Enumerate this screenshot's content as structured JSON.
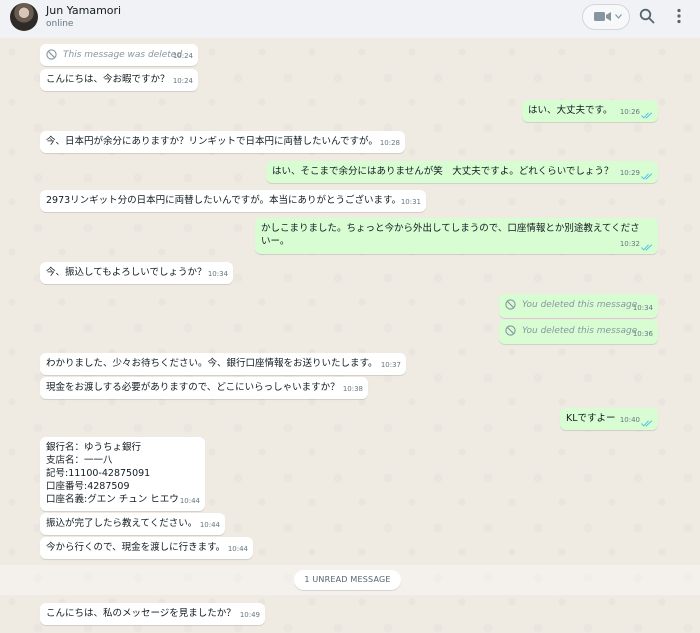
{
  "header": {
    "contact_name": "Jun Yamamori",
    "status": "online",
    "icons": [
      "avatar",
      "video-camera-icon",
      "chevron-down-icon",
      "search-icon",
      "kebab-menu-icon"
    ]
  },
  "colors": {
    "header_bg": "#f0f2f5",
    "chat_bg": "#efeae2",
    "incoming_bubble": "#ffffff",
    "outgoing_bubble": "#d9fdd3",
    "read_ticks": "#53bdeb"
  },
  "messages": [
    {
      "dir": "in",
      "deleted": true,
      "text": "This message was deleted",
      "time": "10:24"
    },
    {
      "dir": "in",
      "text": "こんにちは、今お暇ですか？",
      "time": "10:24"
    },
    {
      "dir": "out",
      "text": "はい、大丈夫です。",
      "time": "10:26"
    },
    {
      "dir": "in",
      "text": "今、日本円が余分にありますか？リンギットで日本円に両替したいんですが。",
      "time": "10:28"
    },
    {
      "dir": "out",
      "text": "はい、そこまで余分にはありませんが笑　大丈夫ですよ。どれくらいでしょう？",
      "time": "10:29"
    },
    {
      "dir": "in",
      "text": "2973リンギット分の日本円に両替したいんですが。本当にありがとうございます。",
      "time": "10:31"
    },
    {
      "dir": "out",
      "text": "かしこまりました。ちょっと今から外出してしまうので、口座情報とか別途教えてくださ\nいー。",
      "time": "10:32"
    },
    {
      "dir": "in",
      "text": "今、振込してもよろしいでしょうか？",
      "time": "10:34"
    },
    {
      "dir": "out",
      "deleted": true,
      "text": "You deleted this message",
      "time": "10:34"
    },
    {
      "dir": "out",
      "deleted": true,
      "text": "You deleted this message",
      "time": "10:36"
    },
    {
      "dir": "in",
      "text": "わかりました、少々お待ちください。今、銀行口座情報をお送りいたします。",
      "time": "10:37"
    },
    {
      "dir": "in",
      "text": "現金をお渡しする必要がありますので、どこにいらっしゃいますか？",
      "time": "10:38"
    },
    {
      "dir": "out",
      "text": "KLですよー",
      "time": "10:40"
    },
    {
      "dir": "in",
      "text": "銀行名：ゆうちょ銀行\n支店名：一一八\n記号:11100-42875091\n口座番号:4287509\n口座名義:グエン チュン ヒエウ",
      "time": "10:44"
    },
    {
      "dir": "in",
      "text": "振込が完了したら教えてください。",
      "time": "10:44"
    },
    {
      "dir": "in",
      "text": "今から行くので、現金を渡しに行きます。",
      "time": "10:44"
    },
    {
      "dir": "in",
      "text": "こんにちは、私のメッセージを見ましたか？",
      "time": "10:49"
    }
  ],
  "unread_label": "1 UNREAD MESSAGE"
}
